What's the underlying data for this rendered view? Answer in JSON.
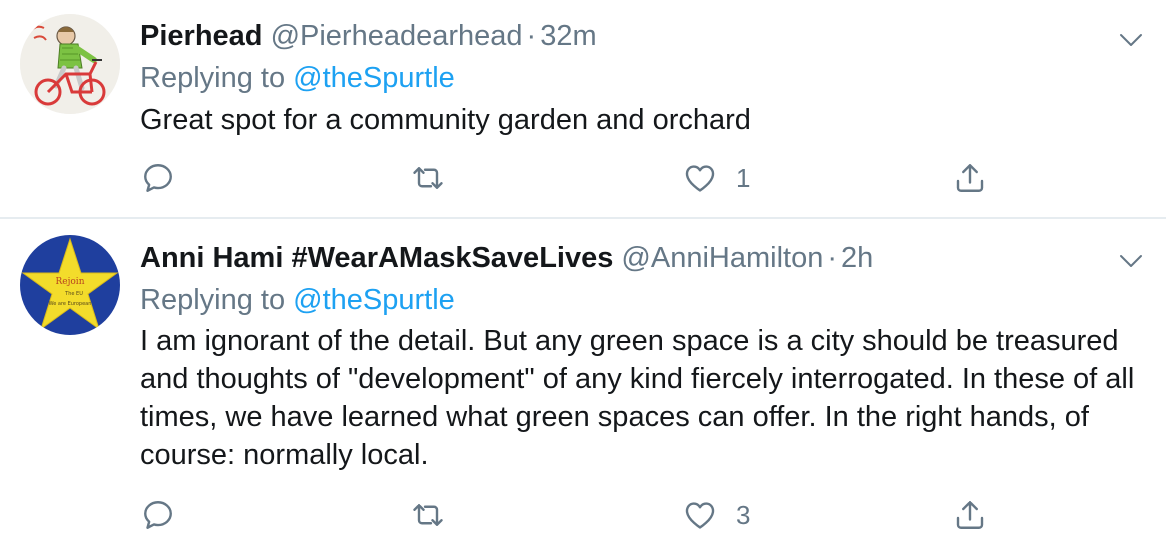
{
  "colors": {
    "accent": "#1da1f2",
    "secondary_text": "#657786",
    "primary_text": "#14171a",
    "divider": "#e6ecf0"
  },
  "tweets": [
    {
      "display_name": "Pierhead",
      "handle": "@Pierheadearhead",
      "separator": "·",
      "time": "32m",
      "replying_prefix": "Replying to",
      "replying_to": "@theSpurtle",
      "text": "Great spot for a community garden and orchard",
      "avatar_icon": "cyclist-drawing-avatar",
      "reply_count": "",
      "retweet_count": "",
      "like_count": "1"
    },
    {
      "display_name": "Anni Hami #WearAMaskSaveLives",
      "handle": "@AnniHamilton",
      "separator": "·",
      "time": "2h",
      "replying_prefix": "Replying to",
      "replying_to": "@theSpurtle",
      "text": "I am ignorant of the detail. But any green space is a city should be treasured and thoughts of \"development\" of any kind fiercely interrogated. In these of all times, we have learned what green spaces can offer. In the right hands, of course: normally local.",
      "avatar_icon": "rejoin-star-avatar",
      "avatar_star_text": [
        "Rejoin",
        "The EU",
        "We are European"
      ],
      "reply_count": "",
      "retweet_count": "",
      "like_count": "3"
    }
  ]
}
